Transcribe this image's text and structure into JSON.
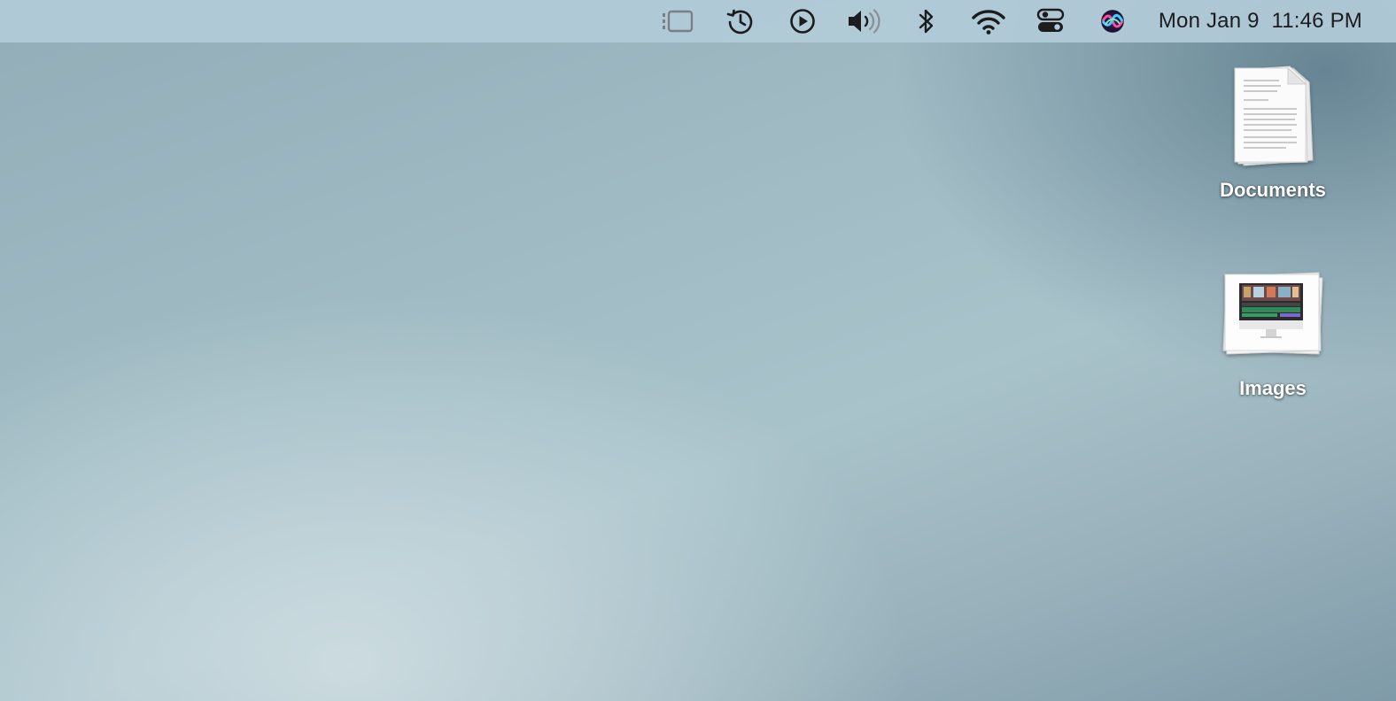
{
  "menubar": {
    "icons": [
      {
        "name": "stage-manager-icon"
      },
      {
        "name": "time-machine-icon"
      },
      {
        "name": "now-playing-icon"
      },
      {
        "name": "volume-icon"
      },
      {
        "name": "bluetooth-icon"
      },
      {
        "name": "wifi-icon"
      },
      {
        "name": "control-center-icon"
      },
      {
        "name": "siri-icon"
      }
    ],
    "date": "Mon Jan 9",
    "time": "11:46 PM"
  },
  "desktop": {
    "items": [
      {
        "label": "Documents",
        "icon": "document-stack-icon"
      },
      {
        "label": "Images",
        "icon": "image-stack-icon"
      }
    ]
  },
  "colors": {
    "menubar_bg": "#b2cbd8",
    "text_dark": "#1c1c1e",
    "label_text": "#ffffff",
    "wallpaper_mid": "#a9c3cb"
  }
}
